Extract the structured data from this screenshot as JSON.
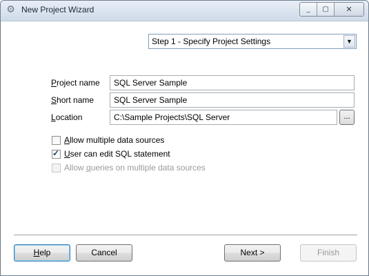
{
  "window": {
    "title": "New Project Wizard",
    "icon": "gear-icon",
    "caption": {
      "minimize": "_",
      "maximize": "▢",
      "close": "✕"
    }
  },
  "step": {
    "selected": "Step 1 - Specify Project Settings"
  },
  "form": {
    "project_name": {
      "label_first": "P",
      "label_rest": "roject name",
      "value": "SQL Server Sample"
    },
    "short_name": {
      "label_first": "S",
      "label_rest": "hort name",
      "value": "SQL Server Sample"
    },
    "location": {
      "label_first": "L",
      "label_rest": "ocation",
      "value": "C:\\Sample Projects\\SQL Server"
    },
    "browse_label": "..."
  },
  "options": [
    {
      "label_pre": "",
      "label_key": "A",
      "label_post": "llow multiple data sources",
      "checked": false,
      "enabled": true
    },
    {
      "label_pre": "",
      "label_key": "U",
      "label_post": "ser can edit SQL statement",
      "checked": true,
      "enabled": true
    },
    {
      "label_pre": "Allow ",
      "label_key": "q",
      "label_post": "ueries on multiple data sources",
      "checked": false,
      "enabled": false
    }
  ],
  "buttons": {
    "help_key": "H",
    "help_rest": "elp",
    "cancel": "Cancel",
    "next": "Next >",
    "finish": "Finish"
  }
}
